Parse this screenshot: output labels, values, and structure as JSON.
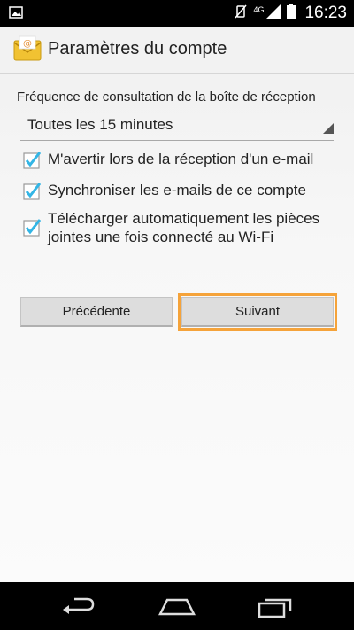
{
  "status_bar": {
    "time": "16:23",
    "network": "4G",
    "icons": [
      "image-notification-icon",
      "mute-icon",
      "signal-icon",
      "battery-icon"
    ]
  },
  "action_bar": {
    "title": "Paramètres du compte",
    "icon": "email-app-icon"
  },
  "form": {
    "frequency_label": "Fréquence de consultation de la boîte de réception",
    "frequency_value": "Toutes les 15 minutes",
    "checkboxes": [
      {
        "label": "M'avertir lors de la réception d'un e-mail",
        "checked": true
      },
      {
        "label": "Synchroniser les e-mails de ce compte",
        "checked": true
      },
      {
        "label": "Télécharger automatiquement les pièces jointes une fois connecté au Wi-Fi",
        "checked": true
      }
    ]
  },
  "buttons": {
    "previous": "Précédente",
    "next": "Suivant"
  },
  "colors": {
    "accent_check": "#33b5e5",
    "highlight": "#f5a33a"
  },
  "nav_bar": {
    "icons": [
      "back-icon",
      "home-icon",
      "recents-icon"
    ]
  }
}
